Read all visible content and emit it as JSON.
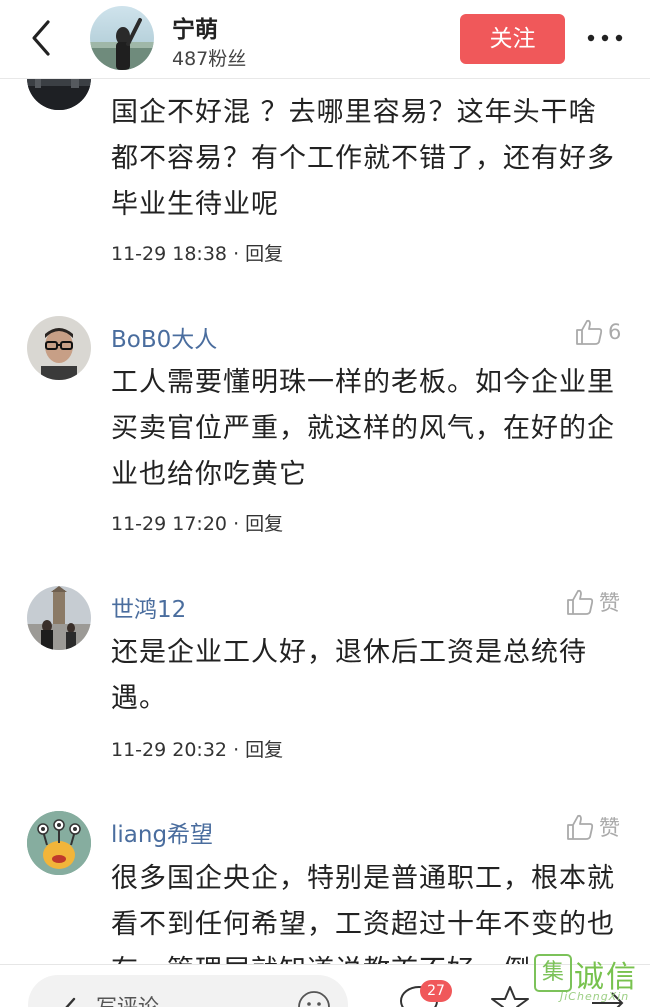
{
  "header": {
    "author_name": "宁萌",
    "fans": "487粉丝",
    "follow_label": "关注"
  },
  "comments": [
    {
      "text": "国企不好混 ？去哪里容易？这年头干啥都不容易？有个工作就不错了，还有好多毕业生待业呢",
      "time": "11-29 18:38",
      "reply": "回复"
    },
    {
      "name": "BoB0大人",
      "likes": "6",
      "text": "工人需要懂明珠一样的老板。如今企业里买卖官位严重，就这样的风气，在好的企业也给你吃黄它",
      "time": "11-29 17:20",
      "reply": "回复"
    },
    {
      "name": "世鸿12",
      "likes": "赞",
      "text": "还是企业工人好，退休后工资是总统待遇。",
      "time": "11-29 20:32",
      "reply": "回复"
    },
    {
      "name": "liang希望",
      "likes": "赞",
      "text": "很多国企央企，特别是普通职工，根本就看不到任何希望，工资超过十年不变的也有，管理层就知道说教首不好，倒"
    }
  ],
  "bottom": {
    "comment_placeholder": "写评论",
    "comment_count": "27"
  },
  "watermark": {
    "box": "集",
    "main": "诚信",
    "sub": "JiChengXin"
  },
  "colors": {
    "accent": "#f0585a",
    "username": "#4a6d9e"
  }
}
